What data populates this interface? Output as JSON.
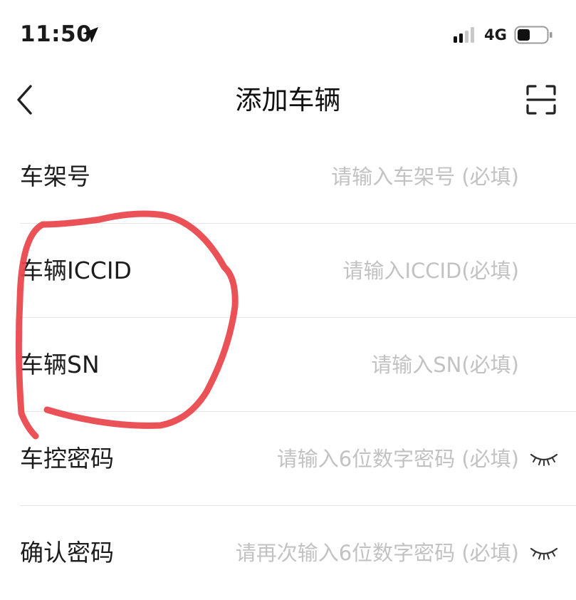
{
  "status_bar": {
    "time": "11:50",
    "network": "4G",
    "icons": [
      "location-arrow-icon",
      "signal-icon",
      "battery-icon"
    ]
  },
  "nav": {
    "title": "添加车辆",
    "back_icon": "chevron-left-icon",
    "scan_icon": "scan-icon"
  },
  "form": {
    "rows": [
      {
        "label": "车架号",
        "placeholder": "请输入车架号 (必填)"
      },
      {
        "label": "车辆ICCID",
        "placeholder": "请输入ICCID(必填)"
      },
      {
        "label": "车辆SN",
        "placeholder": "请输入SN(必填)"
      },
      {
        "label": "车控密码",
        "placeholder": "请输入6位数字密码 (必填)",
        "icon": "eye-closed-icon"
      },
      {
        "label": "确认密码",
        "placeholder": "请再次输入6位数字密码 (必填)",
        "icon": "eye-closed-icon"
      }
    ]
  },
  "colors": {
    "text": "#1c1c1c",
    "placeholder": "#c2c2c2",
    "divider": "#e6e6e6",
    "annotation": "#e8434a"
  }
}
